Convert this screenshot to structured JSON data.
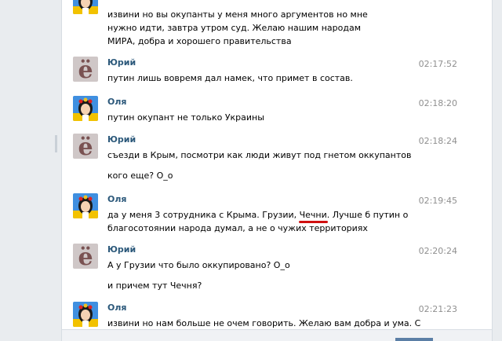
{
  "messages": [
    {
      "author": "",
      "time": "",
      "avatar": "olya",
      "lines": [
        "извини но вы окупанты у меня много аргументов но мне нужно идти, завтра утром суд. Желаю нашим народам МИРА, добра и хорошего правительства"
      ]
    },
    {
      "author": "Юрий",
      "time": "02:17:52",
      "avatar": "yuriy",
      "lines": [
        "путин лишь вовремя дал намек, что примет в состав."
      ]
    },
    {
      "author": "Оля",
      "time": "02:18:20",
      "avatar": "olya",
      "lines": [
        "путин окупант не только Украины"
      ]
    },
    {
      "author": "Юрий",
      "time": "02:18:24",
      "avatar": "yuriy",
      "lines": [
        "съезди в Крым, посмотри как люди живут под гнетом оккупантов",
        "кого еще? О_о"
      ]
    },
    {
      "author": "Оля",
      "time": "02:19:45",
      "avatar": "olya",
      "text_before": "да у меня 3 сотрудника с Крыма. Грузии, ",
      "text_highlight": "Чечни",
      "text_after": ". Лучше б путин о благосотоянии народа думал, а не о чужих территориях"
    },
    {
      "author": "Юрий",
      "time": "02:20:24",
      "avatar": "yuriy",
      "lines": [
        "А у Грузии что было оккупировано? О_о",
        "и причем тут Чечня?"
      ]
    },
    {
      "author": "Оля",
      "time": "02:21:23",
      "avatar": "olya",
      "lines": [
        "извини но нам больше не очем говорить. Желаю вам добра и ума. С"
      ]
    }
  ],
  "avatar_glyph_yuriy": "ё",
  "colors": {
    "author": "#2b587a",
    "time": "#8f8f8f",
    "highlight_underline": "#d01010",
    "yuriy_avatar": "#7a5252",
    "olya_bg": "#3f8fe0"
  }
}
